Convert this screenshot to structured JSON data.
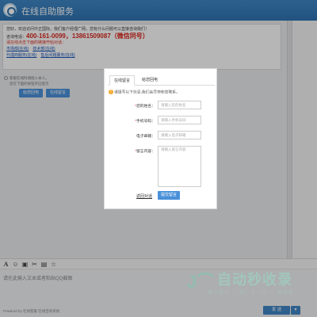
{
  "header": {
    "title": "在线自助服务"
  },
  "welcome": {
    "greeting": "您好，欢迎访问中正国际，我们客户经理广网，您有什么问题可以直接咨询我们！",
    "phone_label": "咨询电话：",
    "phone_numbers": "400-161-0099，13861509087（微信同号）",
    "notice": "请在线点击下面的链接开始对话：",
    "links": [
      "市场部(在线)",
      "技术部(在线)",
      "代理商服务(在线)",
      "售后问题服务(在线)"
    ]
  },
  "system": {
    "line1": "客服在线时请接入本人。",
    "line2": "您在下面的按钮开启提示",
    "btn_callback": "给您回电",
    "btn_leave_msg": "在线留言"
  },
  "toolbar": {
    "icons": [
      "font-icon",
      "emoji-icon",
      "image-icon",
      "screenshot-icon",
      "file-icon",
      "rating-icon"
    ]
  },
  "input": {
    "placeholder": "请在此输入文本或者粘贴QQ截图",
    "hint": "Powered by 在线客服 在线咨询系统",
    "send": "发 送",
    "send_arrow": "▼"
  },
  "modal": {
    "tabs": [
      "在线留言",
      "给您回电"
    ],
    "notice": "请填写以下信息,我们会尽快和您联系。",
    "fields": [
      {
        "label": "您的姓名：",
        "required": true,
        "placeholder": "请输入您的姓名"
      },
      {
        "label": "手机号码：",
        "required": true,
        "placeholder": "请输入手机号码"
      },
      {
        "label": "电子邮箱：",
        "required": false,
        "placeholder": "请输入电子邮箱"
      },
      {
        "label": "留言内容：",
        "required": true,
        "placeholder": "请输入留言内容"
      }
    ],
    "back": "返回对话",
    "submit": "提交留言"
  },
  "watermark": {
    "text": "自动秒收录",
    "sub": "做上排行 一 单一访一次 一 回问率"
  }
}
